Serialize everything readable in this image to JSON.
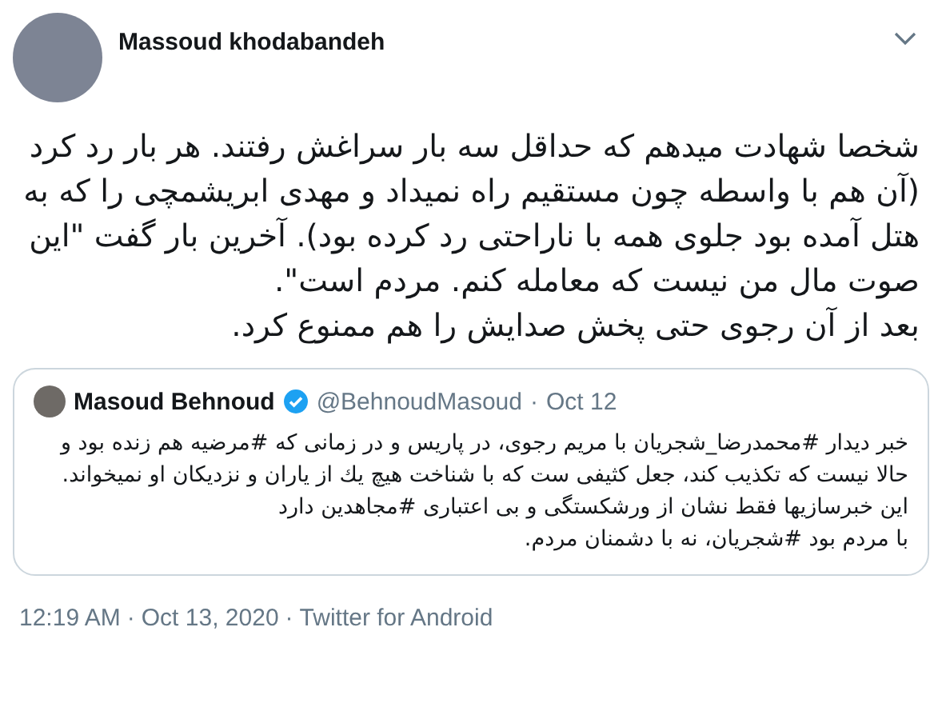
{
  "author": {
    "name": "Massoud khodabandeh"
  },
  "paragraphs": [
    "شخصا شهادت میدهم که حداقل سه بار سراغش رفتند. هر بار رد کرد (آن هم با واسطه چون مستقیم راه نمیداد و مهدی ابریشمچی را که به هتل آمده بود جلوی همه با ناراحتی رد کرده بود). آخرین بار گفت \"این صوت مال من نیست که معامله کنم. مردم است\".",
    "بعد از آن رجوی حتی پخش صدایش را هم ممنوع کرد."
  ],
  "quoted_tweet": {
    "name": "Masoud Behnoud",
    "verified": true,
    "handle": "@BehnoudMasoud",
    "separator": "·",
    "date": "Oct 12",
    "paragraphs": [
      "خبر دیدار #محمدرضا_شجریان با مریم رجوی، در پاریس و در زمانی که #مرضیه هم زنده بود و حالا نیست که تکذیب کند، جعل کثیفی ست که با شناخت هیچ یك از یاران و نزدیکان او نمیخواند.",
      "این خبرسازیها فقط نشان از ورشکستگی و بی اعتباری #مجاهدین دارد",
      "با مردم بود #شجریان، نه با دشمنان مردم."
    ]
  },
  "footer": {
    "time": "12:19 AM",
    "separator_1": "·",
    "date": "Oct 13, 2020",
    "separator_2": "·",
    "source": "Twitter for Android"
  }
}
